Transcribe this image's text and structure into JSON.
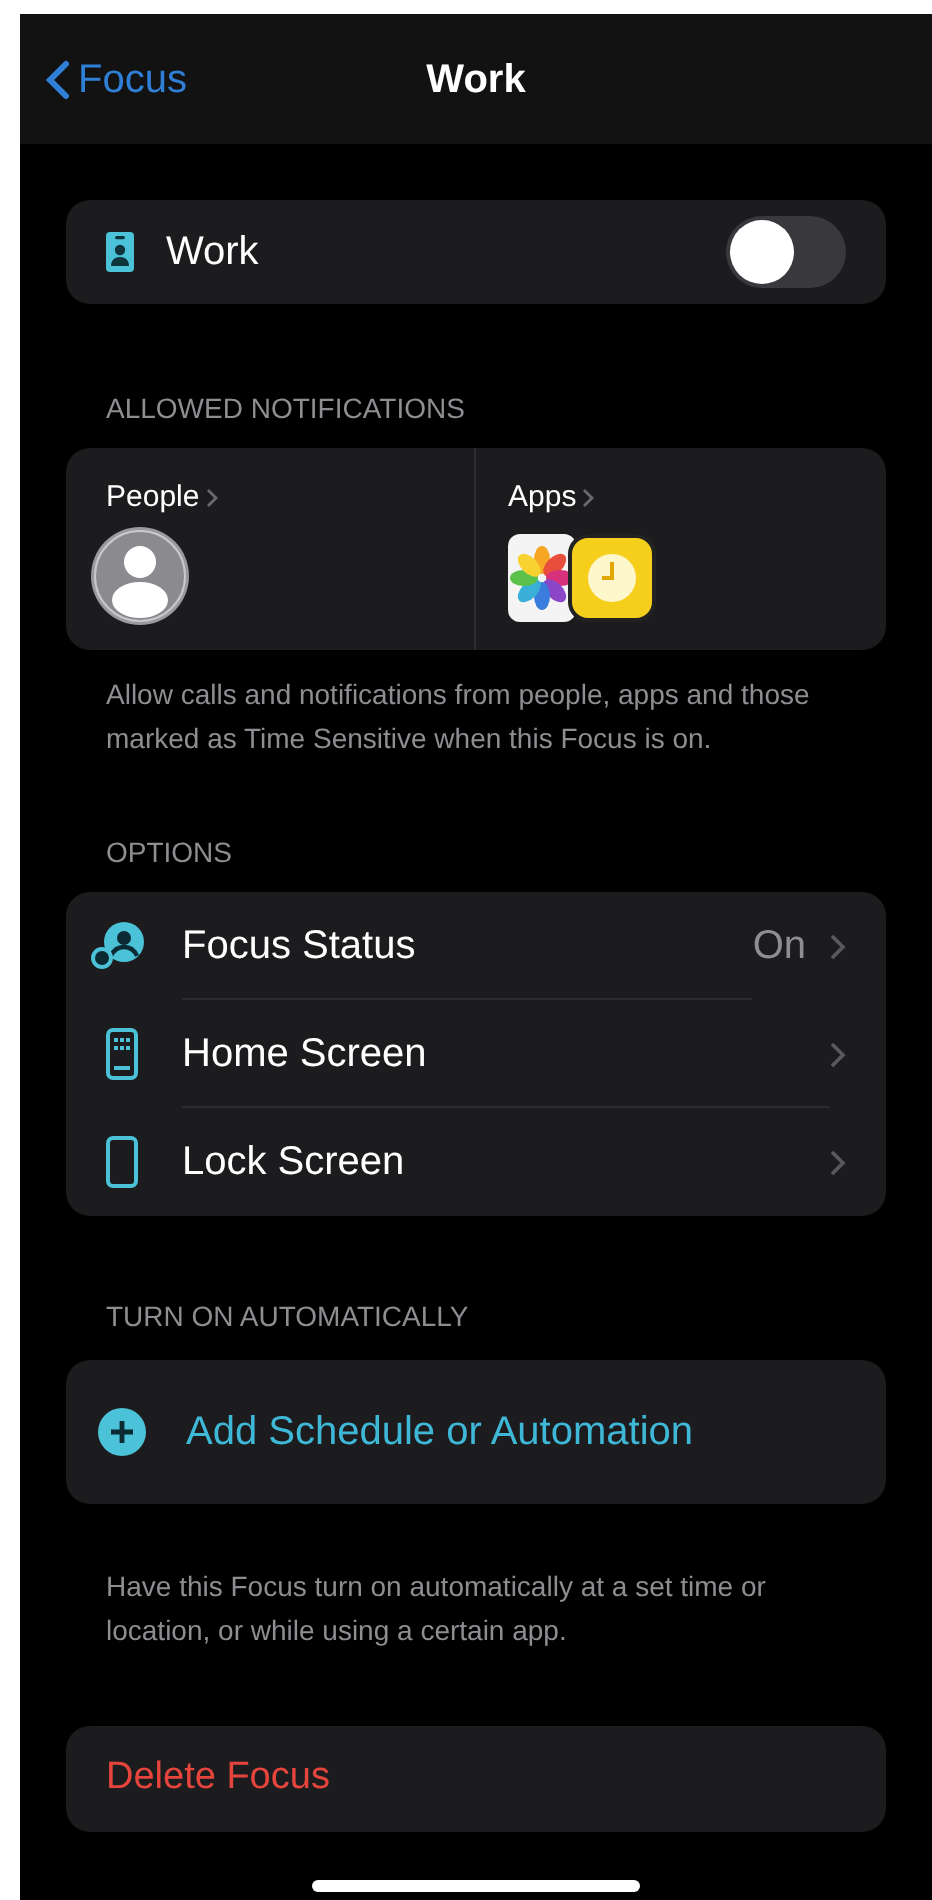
{
  "nav": {
    "back_label": "Focus",
    "title": "Work"
  },
  "focus_toggle": {
    "label": "Work",
    "on": false
  },
  "allowed_notifications": {
    "header": "ALLOWED NOTIFICATIONS",
    "people_label": "People",
    "apps_label": "Apps",
    "footer": "Allow calls and notifications from people, apps and those marked as Time Sensitive when this Focus is on."
  },
  "options": {
    "header": "OPTIONS",
    "rows": [
      {
        "kind": "status",
        "label": "Focus Status",
        "value": "On"
      },
      {
        "kind": "home",
        "label": "Home Screen"
      },
      {
        "kind": "lock",
        "label": "Lock Screen"
      }
    ]
  },
  "automation": {
    "header": "TURN ON AUTOMATICALLY",
    "add_label": "Add Schedule or Automation",
    "footer": "Have this Focus turn on automatically at a set time or location, or while using a certain app."
  },
  "delete_label": "Delete Focus"
}
